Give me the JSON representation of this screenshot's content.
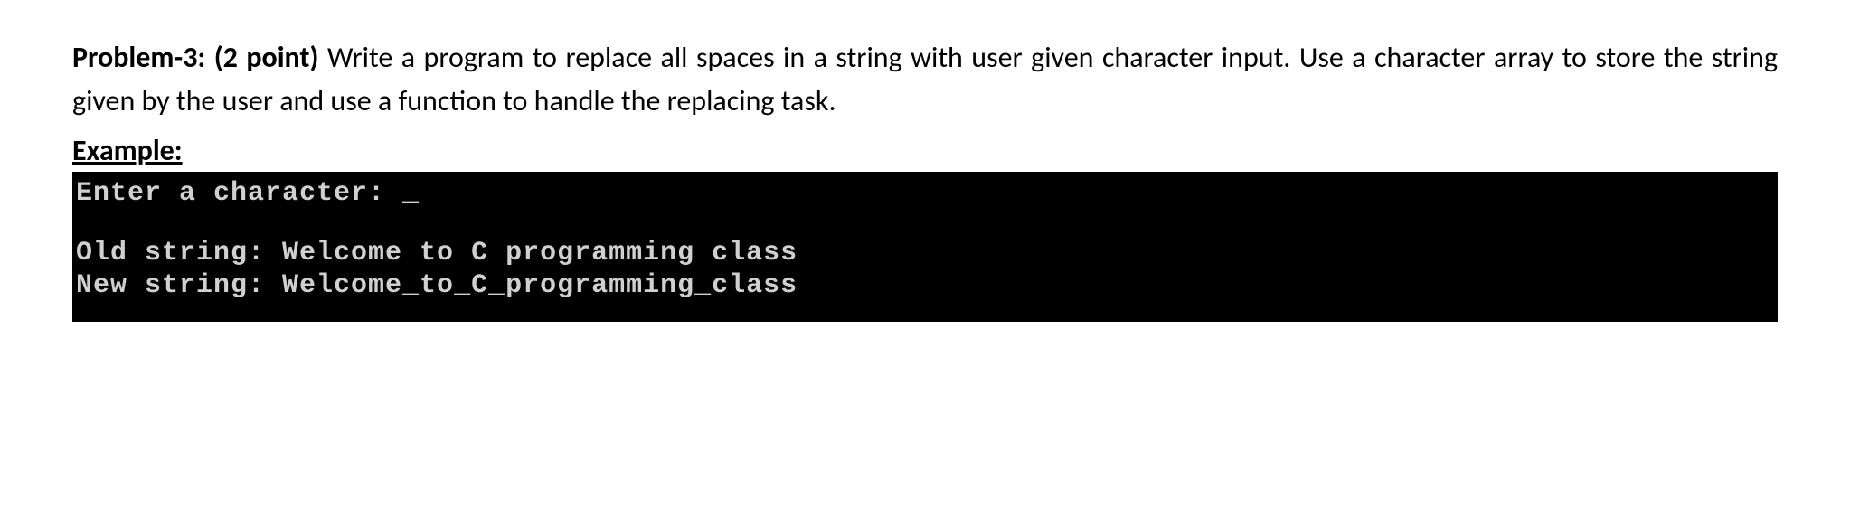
{
  "problem": {
    "label": "Problem-3:",
    "points": "(2 point)",
    "description": "Write a program to replace all spaces in a string with user given character input. Use a character array to store the string given by the user and use a function to handle the replacing task."
  },
  "example": {
    "label": "Example:"
  },
  "terminal": {
    "line1": "Enter a character: _",
    "line2": "",
    "line3": "Old string: Welcome to C programming class",
    "line4": "New string: Welcome_to_C_programming_class"
  }
}
